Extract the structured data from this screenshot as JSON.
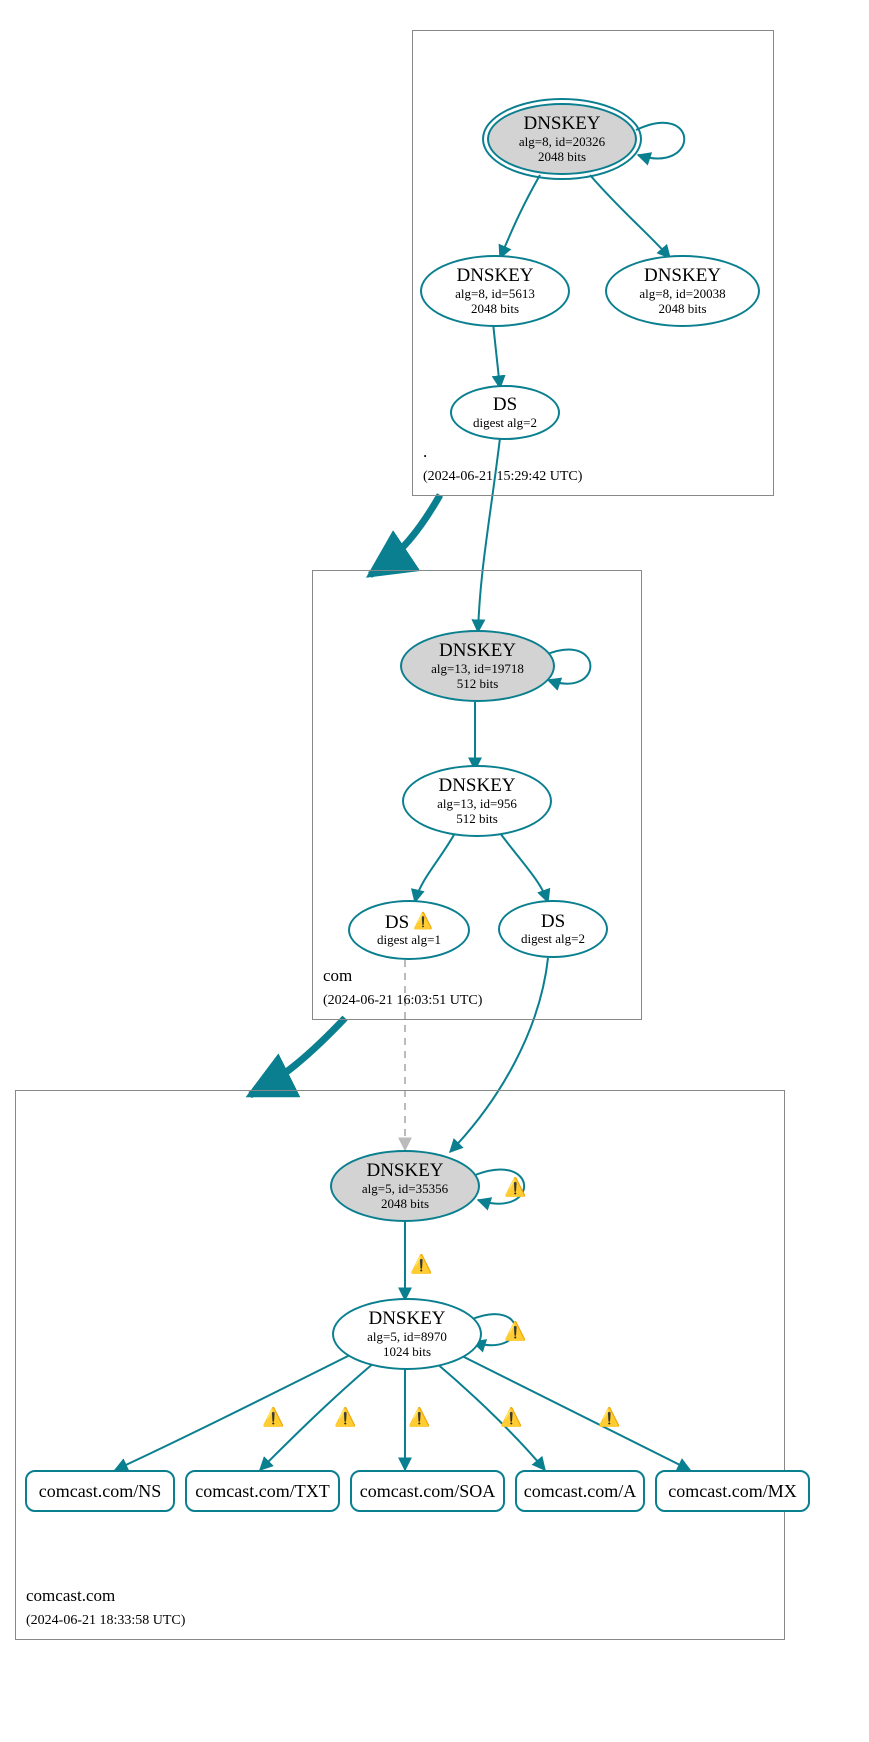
{
  "zones": {
    "root": {
      "name": ".",
      "timestamp": "(2024-06-21 15:29:42 UTC)"
    },
    "com": {
      "name": "com",
      "timestamp": "(2024-06-21 16:03:51 UTC)"
    },
    "leaf": {
      "name": "comcast.com",
      "timestamp": "(2024-06-21 18:33:58 UTC)"
    }
  },
  "nodes": {
    "root_ksk": {
      "title": "DNSKEY",
      "line2": "alg=8, id=20326",
      "line3": "2048 bits"
    },
    "root_zsk": {
      "title": "DNSKEY",
      "line2": "alg=8, id=5613",
      "line3": "2048 bits"
    },
    "root_zsk2": {
      "title": "DNSKEY",
      "line2": "alg=8, id=20038",
      "line3": "2048 bits"
    },
    "root_ds": {
      "title": "DS",
      "line2": "digest alg=2"
    },
    "com_ksk": {
      "title": "DNSKEY",
      "line2": "alg=13, id=19718",
      "line3": "512 bits"
    },
    "com_zsk": {
      "title": "DNSKEY",
      "line2": "alg=13, id=956",
      "line3": "512 bits"
    },
    "com_ds1": {
      "title": "DS",
      "line2": "digest alg=1"
    },
    "com_ds2": {
      "title": "DS",
      "line2": "digest alg=2"
    },
    "leaf_ksk": {
      "title": "DNSKEY",
      "line2": "alg=5, id=35356",
      "line3": "2048 bits"
    },
    "leaf_zsk": {
      "title": "DNSKEY",
      "line2": "alg=5, id=8970",
      "line3": "1024 bits"
    }
  },
  "rr": {
    "ns": "comcast.com/NS",
    "txt": "comcast.com/TXT",
    "soa": "comcast.com/SOA",
    "a": "comcast.com/A",
    "mx": "comcast.com/MX"
  },
  "icons": {
    "warn": "⚠️"
  }
}
